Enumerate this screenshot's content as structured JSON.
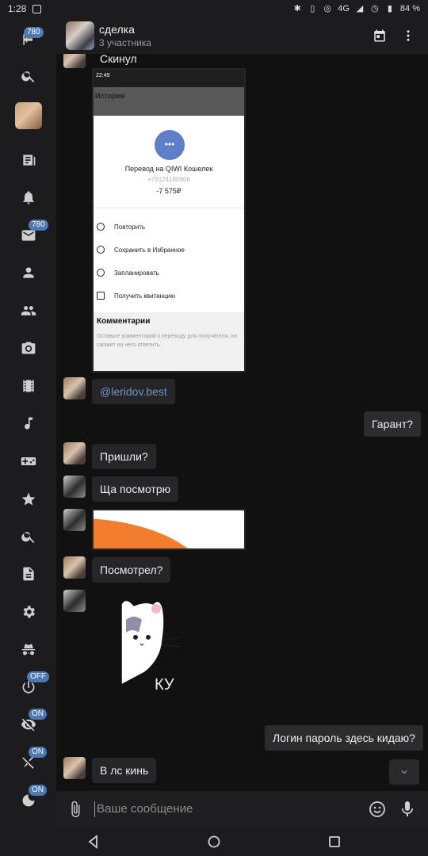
{
  "status_bar": {
    "time": "1:28",
    "network": "4G",
    "battery": "84 %"
  },
  "rail": {
    "items": [
      {
        "icon": "exit-icon",
        "badge": "780"
      },
      {
        "icon": "search-icon"
      },
      {
        "icon": "profile-avatar"
      },
      {
        "icon": "news-icon"
      },
      {
        "icon": "bell-icon"
      },
      {
        "icon": "mail-icon",
        "badge": "780"
      },
      {
        "icon": "person-icon"
      },
      {
        "icon": "people-icon"
      },
      {
        "icon": "camera-icon"
      },
      {
        "icon": "film-icon"
      },
      {
        "icon": "music-icon"
      },
      {
        "icon": "gamepad-icon"
      },
      {
        "icon": "star-icon"
      },
      {
        "icon": "search-icon"
      },
      {
        "icon": "document-icon"
      },
      {
        "icon": "settings-icon"
      },
      {
        "icon": "incognito-icon"
      },
      {
        "icon": "power-icon",
        "badge": "OFF"
      },
      {
        "icon": "eye-off-icon",
        "badge": "ON"
      },
      {
        "icon": "pin-off-icon",
        "badge": "ON"
      },
      {
        "icon": "moon-icon",
        "badge": "ON"
      }
    ]
  },
  "header": {
    "title": "сделка",
    "subtitle": "3 участника"
  },
  "screenshot_embed": {
    "time": "22:49",
    "history": "История",
    "transfer_title": "Перевод на QIWI Кошелек",
    "phone": "+79124180966",
    "amount": "-7 575₽",
    "actions": [
      "Повторить",
      "Сохранить в Избранное",
      "Запланировать",
      "Получить квитанцию"
    ],
    "comments_title": "Комментарии",
    "comments_hint": "Оставьте комментарий к переводу для получателя, он сможет на него ответить."
  },
  "messages": [
    {
      "text": "Скинул"
    },
    {
      "text": "@leridov.best"
    },
    {
      "text": "Гарант?"
    },
    {
      "text": "Пришли?"
    },
    {
      "text": "Ща посмотрю"
    },
    {
      "text": "Посмотрел?"
    },
    {
      "text": "Логин пароль здесь кидаю?"
    },
    {
      "text": "В лс кинь"
    }
  ],
  "sticker_text": "КУ",
  "composer": {
    "placeholder": "Ваше сообщение"
  }
}
